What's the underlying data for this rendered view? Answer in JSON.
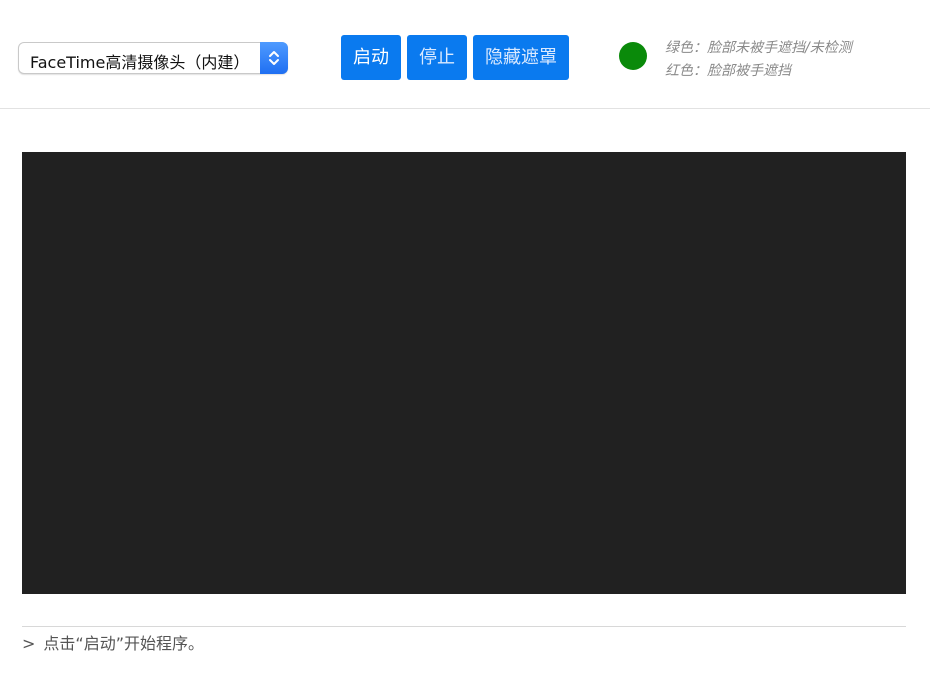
{
  "toolbar": {
    "camera_select": {
      "selected": "FaceTime高清摄像头（内建）"
    },
    "buttons": {
      "start": "启动",
      "stop": "停止",
      "hide_mask": "隐藏遮罩"
    },
    "status": {
      "color": "#0a8a0a"
    },
    "legend": {
      "green": "绿色：脸部未被手遮挡/未检测",
      "red": "红色：脸部被手遮挡"
    }
  },
  "video": {
    "background": "#212121"
  },
  "log": {
    "prompt": ">",
    "message": "点击“启动”开始程序。"
  }
}
